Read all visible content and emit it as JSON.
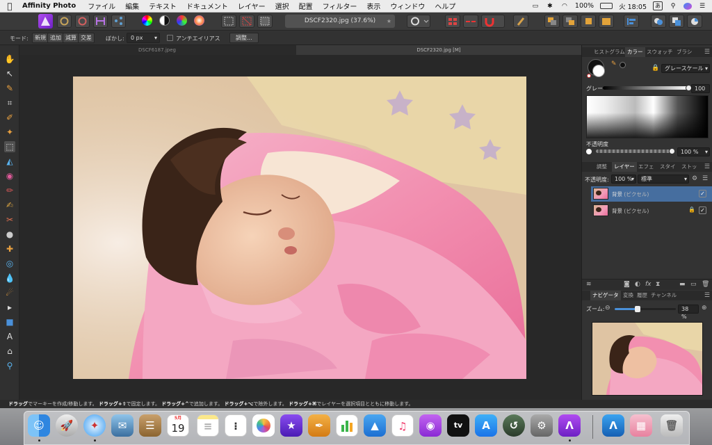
{
  "menubar": {
    "app_name": "Affinity Photo",
    "items": [
      "ファイル",
      "編集",
      "テキスト",
      "ドキュメント",
      "レイヤー",
      "選択",
      "配置",
      "フィルター",
      "表示",
      "ウィンドウ",
      "ヘルプ"
    ],
    "battery": "100%",
    "time": "火 18:05",
    "input_mode": "あ"
  },
  "toolbar": {
    "document_title": "DSCF2320.jpg (37.6%)"
  },
  "context_bar": {
    "mode_label": "モード:",
    "modes": [
      "新規",
      "追加",
      "減算",
      "交差"
    ],
    "feather_label": "ぼかし:",
    "feather_value": "0 px",
    "antialias_label": "アンチエイリアス",
    "refine_button": "調整..."
  },
  "doc_tabs": [
    "DSCF6187.jpeg",
    "DSCF2320.jpg [M]"
  ],
  "color_panel": {
    "tabs": [
      "ヒストグラム",
      "カラー",
      "スウォッチ",
      "ブラシ"
    ],
    "active_tab": "カラー",
    "mode": "グレースケール",
    "gray_label": "グレー",
    "gray_value": "100",
    "opacity_label": "不透明度",
    "opacity_value": "100 %"
  },
  "layers_panel": {
    "tabs": [
      "調整",
      "レイヤー",
      "エフェ",
      "スタイ",
      "ストッ"
    ],
    "active_tab": "レイヤー",
    "opacity_label": "不透明度:",
    "opacity_value": "100 %",
    "blend_mode": "標準",
    "layers": [
      {
        "name": "背景",
        "kind": "(ピクセル)",
        "visible": true,
        "locked": false
      },
      {
        "name": "背景",
        "kind": "(ピクセル)",
        "visible": true,
        "locked": true
      }
    ]
  },
  "navigator_panel": {
    "tabs": [
      "ナビゲータ",
      "変換",
      "履歴",
      "チャンネル"
    ],
    "active_tab": "ナビゲータ",
    "zoom_label": "ズーム:",
    "zoom_value": "38 %",
    "zoom_slider_fraction": 0.38
  },
  "status": {
    "s1": "ドラッグ",
    "t1": "でマーキーを作成/移動します。",
    "s2": "ドラッグ+⇧",
    "t2": "で固定します。",
    "s3": "ドラッグ+^",
    "t3": "で追加します。",
    "s4": "ドラッグ+⌥",
    "t4": "で除外します。",
    "s5": "ドラッグ+⌘",
    "t5": "でレイヤーを選択項目とともに移動します。"
  },
  "dock": {
    "calendar_month": "5月",
    "calendar_day": "19",
    "tv_label": "tv"
  },
  "colors": {
    "accent_selection": "#466e9f",
    "persona_purple": "#8a36dd"
  }
}
